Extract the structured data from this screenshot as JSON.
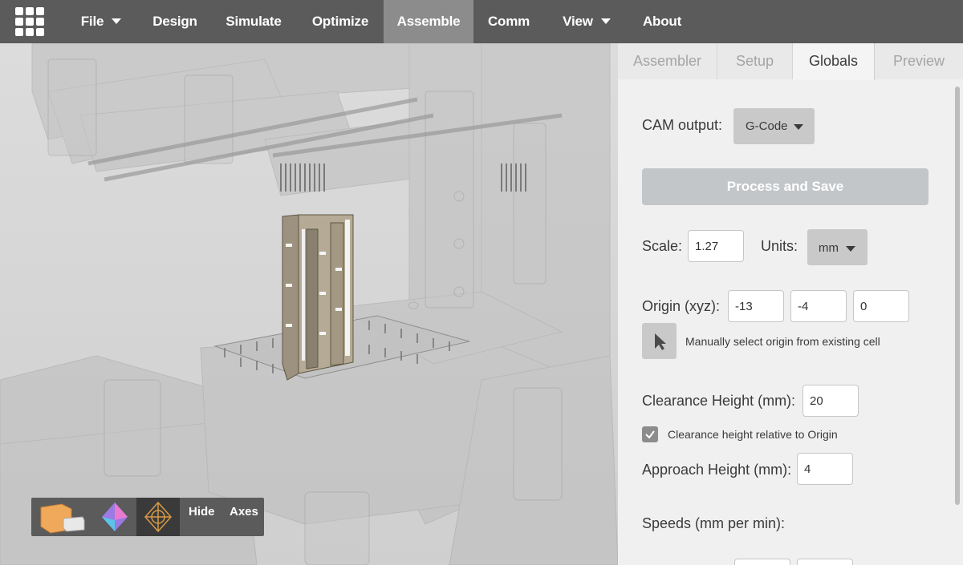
{
  "nav": {
    "items": [
      {
        "label": "File",
        "has_caret": true
      },
      {
        "label": "Design",
        "has_caret": false
      },
      {
        "label": "Simulate",
        "has_caret": false
      },
      {
        "label": "Optimize",
        "has_caret": false
      },
      {
        "label": "Assemble",
        "has_caret": false,
        "active": true
      },
      {
        "label": "Comm",
        "has_caret": false
      },
      {
        "label": "View",
        "has_caret": true
      },
      {
        "label": "About",
        "has_caret": false
      }
    ]
  },
  "viewport": {
    "toolbar": {
      "hide_label": "Hide",
      "axes_label": "Axes"
    }
  },
  "panel": {
    "tabs": [
      {
        "label": "Assembler",
        "active": false
      },
      {
        "label": "Setup",
        "active": false
      },
      {
        "label": "Globals",
        "active": true
      },
      {
        "label": "Preview",
        "active": false
      }
    ],
    "cam_output_label": "CAM output:",
    "cam_output_value": "G-Code",
    "process_button": "Process and Save",
    "scale_label": "Scale:",
    "scale_value": "1.27",
    "units_label": "Units:",
    "units_value": "mm",
    "origin_label": "Origin (xyz):",
    "origin_x": "-13",
    "origin_y": "-4",
    "origin_z": "0",
    "manual_origin_text": "Manually select origin from existing cell",
    "clearance_label": "Clearance Height (mm):",
    "clearance_value": "20",
    "clearance_relative_text": "Clearance height relative to Origin",
    "clearance_relative_checked": true,
    "approach_label": "Approach Height (mm):",
    "approach_value": "4",
    "speeds_label": "Speeds (mm per min):"
  },
  "colors": {
    "nav_bg": "#5b5b5b",
    "nav_active": "#8c8c8c",
    "panel_bg": "#f0f0f0",
    "primary_button": "#c3c6c9"
  }
}
